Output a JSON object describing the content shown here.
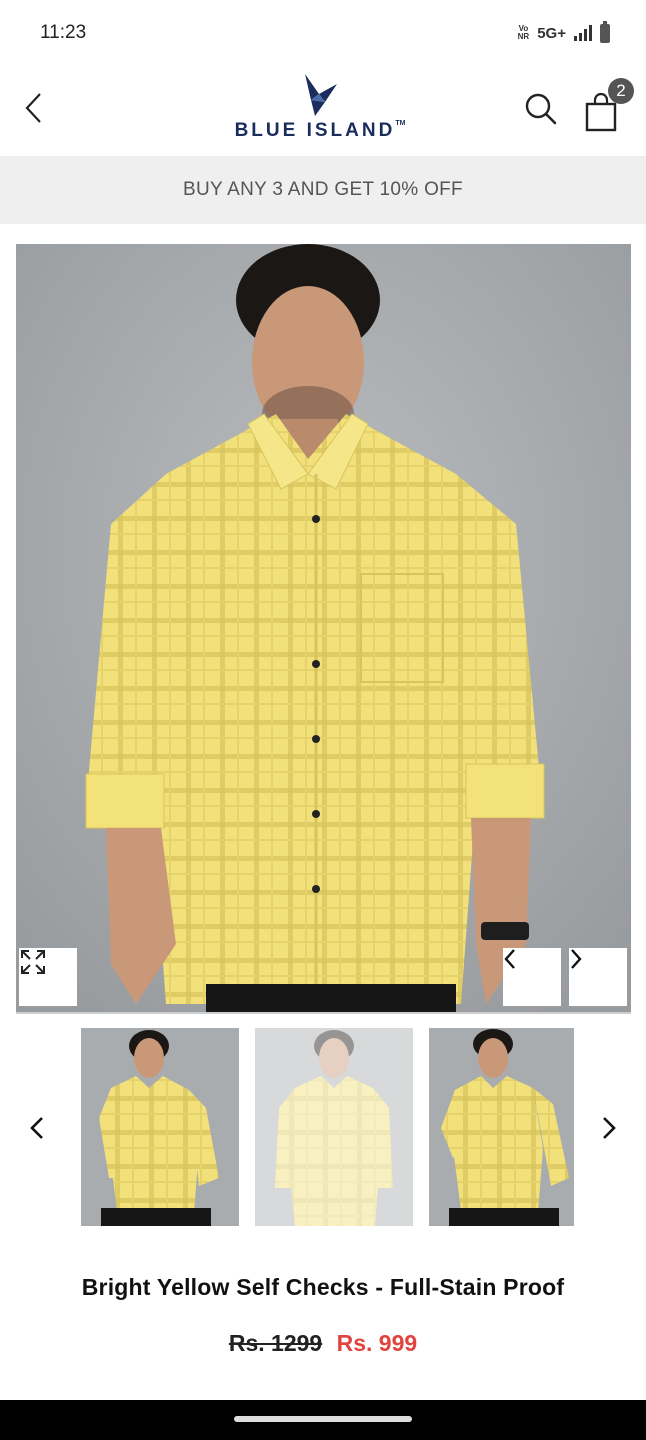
{
  "status_bar": {
    "time": "11:23",
    "volte_top": "Vo",
    "volte_bottom": "NR",
    "network": "5G+",
    "signal_icon": "signal-bars-icon",
    "battery_icon": "battery-icon"
  },
  "header": {
    "back_icon": "chevron-left-icon",
    "brand": "BLUE ISLAND",
    "brand_tm": "TM",
    "search_icon": "search-icon",
    "cart_icon": "shopping-bag-icon",
    "cart_count": "2"
  },
  "promo": {
    "text": "BUY ANY 3 AND GET 10% OFF"
  },
  "gallery": {
    "expand_icon": "expand-icon",
    "prev_icon": "chevron-left-icon",
    "next_icon": "chevron-right-icon",
    "thumbnails_count": 3,
    "active_thumbnail": 2
  },
  "product": {
    "title": "Bright Yellow Self Checks - Full-Stain Proof",
    "price_old": "Rs. 1299",
    "price_new": "Rs. 999"
  },
  "colors": {
    "brand_navy": "#1a2d5c",
    "price_sale": "#e0443e",
    "promo_bg": "#efefef",
    "shirt_yellow": "#f3e27a"
  }
}
